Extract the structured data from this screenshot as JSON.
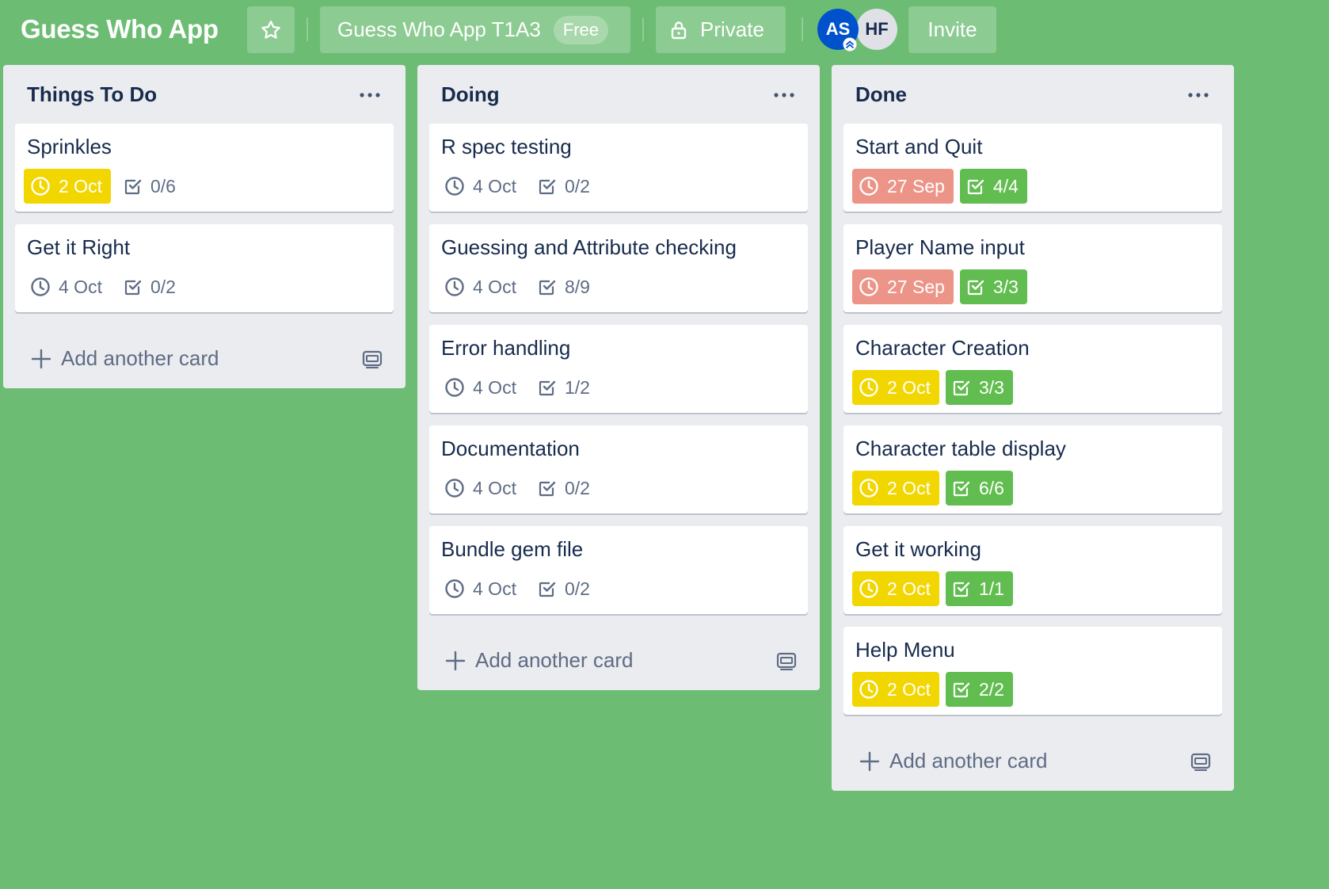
{
  "header": {
    "board_title": "Guess Who App",
    "board_name": "Guess Who App T1A3",
    "plan_badge": "Free",
    "visibility": "Private",
    "members": [
      {
        "initials": "AS",
        "color": "#0052cc"
      },
      {
        "initials": "HF",
        "color": "#dfe1e6"
      }
    ],
    "invite_label": "Invite"
  },
  "colors": {
    "background": "#6cbd73",
    "due_soon": "#f2d600",
    "overdue": "#ec9488",
    "complete": "#61bd4f"
  },
  "lists": [
    {
      "title": "Things To Do",
      "add_card_label": "Add another card",
      "cards": [
        {
          "title": "Sprinkles",
          "due": "2 Oct",
          "due_status": "due-yellow",
          "checklist": "0/6",
          "check_status": "plain"
        },
        {
          "title": "Get it Right",
          "due": "4 Oct",
          "due_status": "plain",
          "checklist": "0/2",
          "check_status": "plain"
        }
      ]
    },
    {
      "title": "Doing",
      "add_card_label": "Add another card",
      "cards": [
        {
          "title": "R spec testing",
          "due": "4 Oct",
          "due_status": "plain",
          "checklist": "0/2",
          "check_status": "plain"
        },
        {
          "title": "Guessing and Attribute checking",
          "due": "4 Oct",
          "due_status": "plain",
          "checklist": "8/9",
          "check_status": "plain"
        },
        {
          "title": "Error handling",
          "due": "4 Oct",
          "due_status": "plain",
          "checklist": "1/2",
          "check_status": "plain"
        },
        {
          "title": "Documentation",
          "due": "4 Oct",
          "due_status": "plain",
          "checklist": "0/2",
          "check_status": "plain"
        },
        {
          "title": "Bundle gem file",
          "due": "4 Oct",
          "due_status": "plain",
          "checklist": "0/2",
          "check_status": "plain"
        }
      ]
    },
    {
      "title": "Done",
      "add_card_label": "Add another card",
      "cards": [
        {
          "title": "Start and Quit",
          "due": "27 Sep",
          "due_status": "due-red",
          "checklist": "4/4",
          "check_status": "check-green"
        },
        {
          "title": "Player Name input",
          "due": "27 Sep",
          "due_status": "due-red",
          "checklist": "3/3",
          "check_status": "check-green"
        },
        {
          "title": "Character Creation",
          "due": "2 Oct",
          "due_status": "due-yellow",
          "checklist": "3/3",
          "check_status": "check-green"
        },
        {
          "title": "Character table display",
          "due": "2 Oct",
          "due_status": "due-yellow",
          "checklist": "6/6",
          "check_status": "check-green"
        },
        {
          "title": "Get it working",
          "due": "2 Oct",
          "due_status": "due-yellow",
          "checklist": "1/1",
          "check_status": "check-green"
        },
        {
          "title": "Help Menu",
          "due": "2 Oct",
          "due_status": "due-yellow",
          "checklist": "2/2",
          "check_status": "check-green"
        }
      ]
    }
  ]
}
